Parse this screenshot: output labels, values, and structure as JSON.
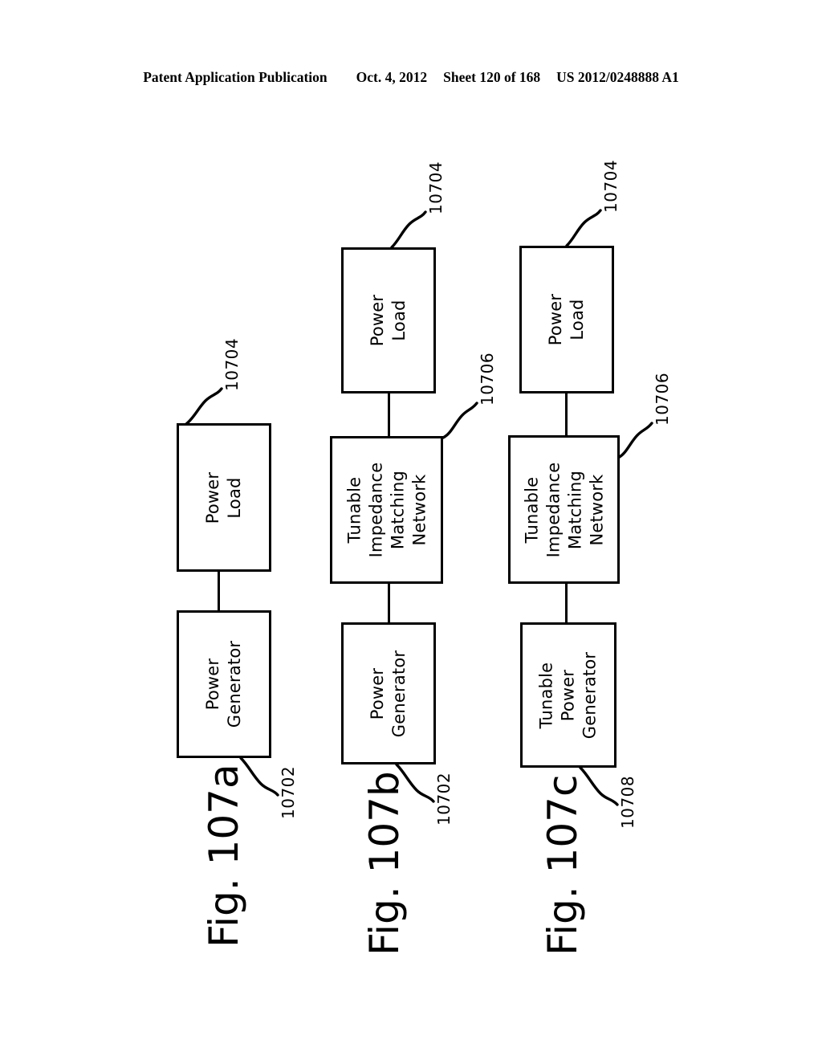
{
  "header": {
    "publication": "Patent Application Publication",
    "date": "Oct. 4, 2012",
    "sheet": "Sheet 120 of 168",
    "patent_number": "US 2012/0248888 A1"
  },
  "figures": [
    {
      "caption": "Fig. 107a",
      "blocks": [
        {
          "name": "power-load",
          "lines": [
            "Power",
            "Load"
          ],
          "ref": "10704"
        },
        {
          "name": "power-generator",
          "lines": [
            "Power",
            "Generator"
          ],
          "ref": "10702"
        }
      ]
    },
    {
      "caption": "Fig. 107b",
      "blocks": [
        {
          "name": "power-load",
          "lines": [
            "Power",
            "Load"
          ],
          "ref": "10704"
        },
        {
          "name": "tunable-impedance-matching-network",
          "lines": [
            "Tunable",
            "Impedance",
            "Matching",
            "Network"
          ],
          "ref": "10706"
        },
        {
          "name": "power-generator",
          "lines": [
            "Power",
            "Generator"
          ],
          "ref": "10702"
        }
      ]
    },
    {
      "caption": "Fig. 107c",
      "blocks": [
        {
          "name": "power-load",
          "lines": [
            "Power",
            "Load"
          ],
          "ref": "10704"
        },
        {
          "name": "tunable-impedance-matching-network",
          "lines": [
            "Tunable",
            "Impedance",
            "Matching",
            "Network"
          ],
          "ref": "10706"
        },
        {
          "name": "tunable-power-generator",
          "lines": [
            "Tunable",
            "Power",
            "Generator"
          ],
          "ref": "10708"
        }
      ]
    }
  ],
  "colors": {
    "ink": "#000000",
    "paper": "#ffffff"
  }
}
